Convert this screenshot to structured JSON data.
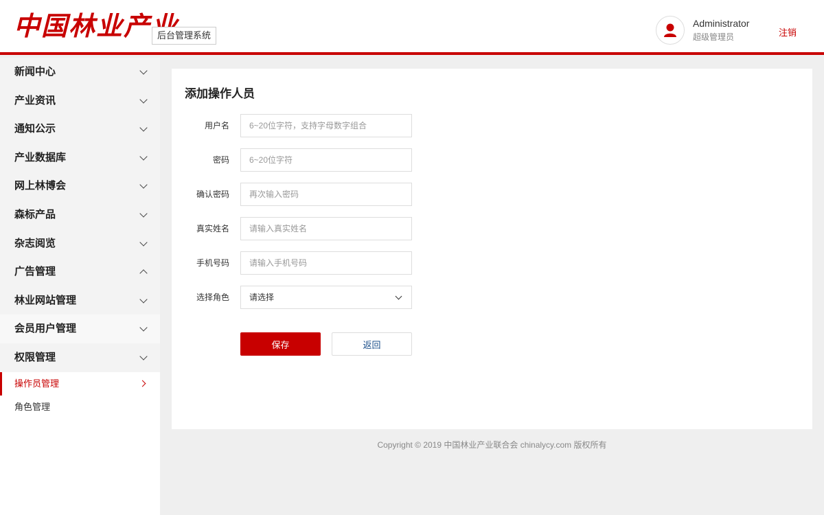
{
  "header": {
    "logo_text": "中国林业产业",
    "system_name": "后台管理系统",
    "user_name": "Administrator",
    "user_role": "超级管理员",
    "logout_label": "注销"
  },
  "sidebar": {
    "items": [
      {
        "label": "新闻中心",
        "expanded": false
      },
      {
        "label": "产业资讯",
        "expanded": false
      },
      {
        "label": "通知公示",
        "expanded": false
      },
      {
        "label": "产业数据库",
        "expanded": false
      },
      {
        "label": "网上林博会",
        "expanded": false
      },
      {
        "label": "森标产品",
        "expanded": false
      },
      {
        "label": "杂志阅览",
        "expanded": false
      },
      {
        "label": "广告管理",
        "expanded": true
      },
      {
        "label": "林业网站管理",
        "expanded": false
      },
      {
        "label": "会员用户管理",
        "expanded": false
      },
      {
        "label": "权限管理",
        "expanded": true
      }
    ],
    "sub_items": [
      {
        "label": "操作员管理",
        "active": true
      },
      {
        "label": "角色管理",
        "active": false
      }
    ]
  },
  "form": {
    "title": "添加操作人员",
    "fields": [
      {
        "label": "用户名",
        "placeholder": "6~20位字符，支持字母数字组合",
        "value": ""
      },
      {
        "label": "密码",
        "placeholder": "6~20位字符",
        "value": ""
      },
      {
        "label": "确认密码",
        "placeholder": "再次输入密码",
        "value": ""
      },
      {
        "label": "真实姓名",
        "placeholder": "请输入真实姓名",
        "value": ""
      },
      {
        "label": "手机号码",
        "placeholder": "请输入手机号码",
        "value": ""
      }
    ],
    "role": {
      "label": "选择角色",
      "selected": "请选择"
    },
    "save_label": "保存",
    "back_label": "返回"
  },
  "footer": {
    "copyright": "Copyright © 2019 中国林业产业联合会 chinalycy.com 版权所有"
  },
  "colors": {
    "accent": "#c80000",
    "link": "#1a4e8a"
  }
}
